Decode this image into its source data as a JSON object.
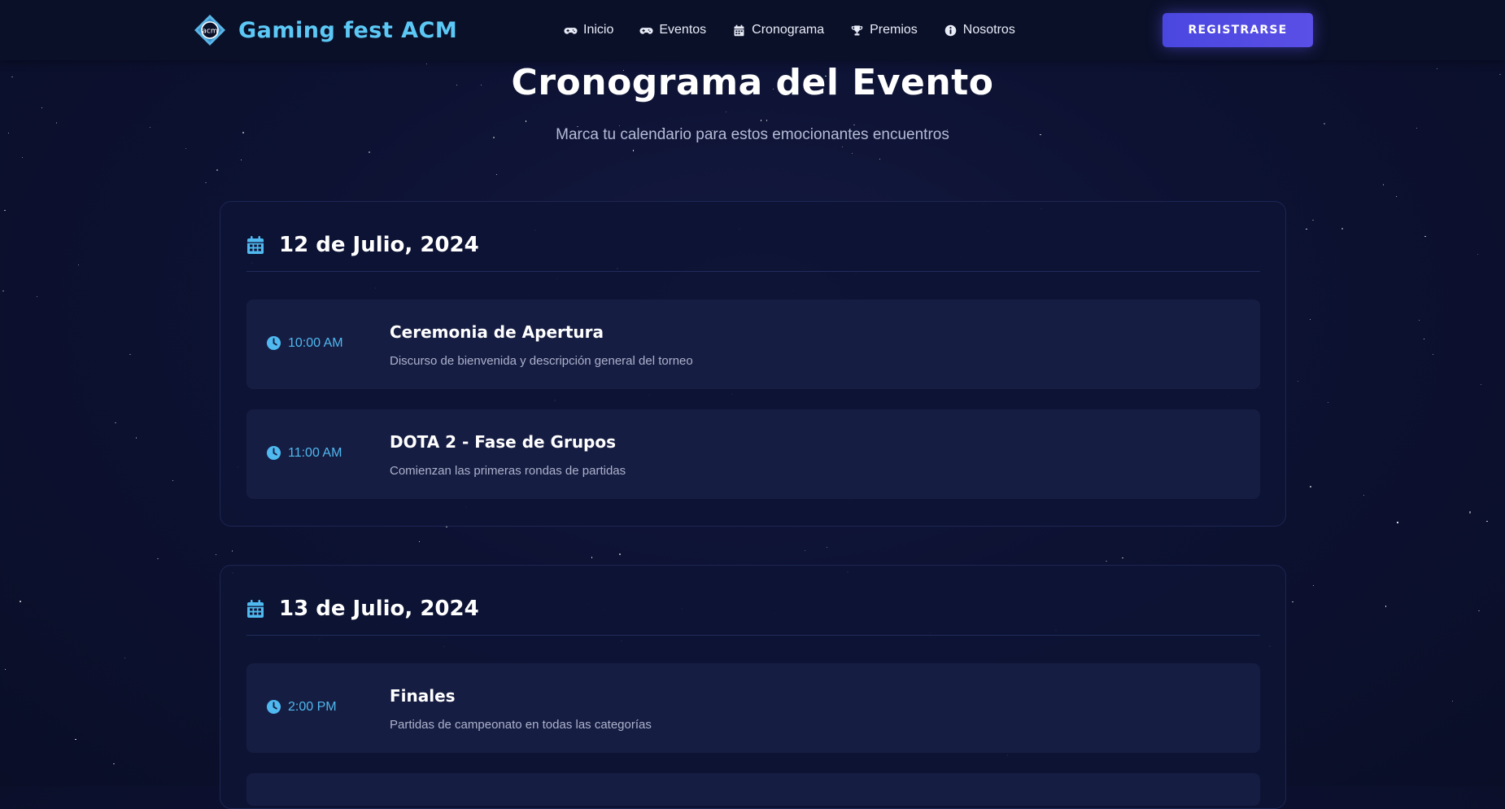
{
  "nav": {
    "brand": "Gaming fest ACM",
    "logo_text": "acm",
    "links": [
      {
        "label": "Inicio",
        "icon": "gamepad-icon"
      },
      {
        "label": "Eventos",
        "icon": "gamepad-icon"
      },
      {
        "label": "Cronograma",
        "icon": "calendar-icon"
      },
      {
        "label": "Premios",
        "icon": "trophy-icon"
      },
      {
        "label": "Nosotros",
        "icon": "info-icon"
      }
    ],
    "register_label": "REGISTRARSE"
  },
  "header": {
    "title": "Cronograma del Evento",
    "subtitle": "Marca tu calendario para estos emocionantes encuentros"
  },
  "schedule": [
    {
      "date": "12 de Julio, 2024",
      "events": [
        {
          "time": "10:00 AM",
          "title": "Ceremonia de Apertura",
          "description": "Discurso de bienvenida y descripción general del torneo"
        },
        {
          "time": "11:00 AM",
          "title": "DOTA 2 - Fase de Grupos",
          "description": "Comienzan las primeras rondas de partidas"
        }
      ]
    },
    {
      "date": "13 de Julio, 2024",
      "events": [
        {
          "time": "2:00 PM",
          "title": "Finales",
          "description": "Partidas de campeonato en todas las categorías"
        }
      ]
    }
  ],
  "colors": {
    "background": "#0a0e27",
    "navbar": "#0b1029",
    "accent_blue": "#4fb9f0",
    "brand_cyan": "#5cc8f5",
    "button": "#4a47e0",
    "card": "#0d1334",
    "event_item": "#161d42"
  }
}
